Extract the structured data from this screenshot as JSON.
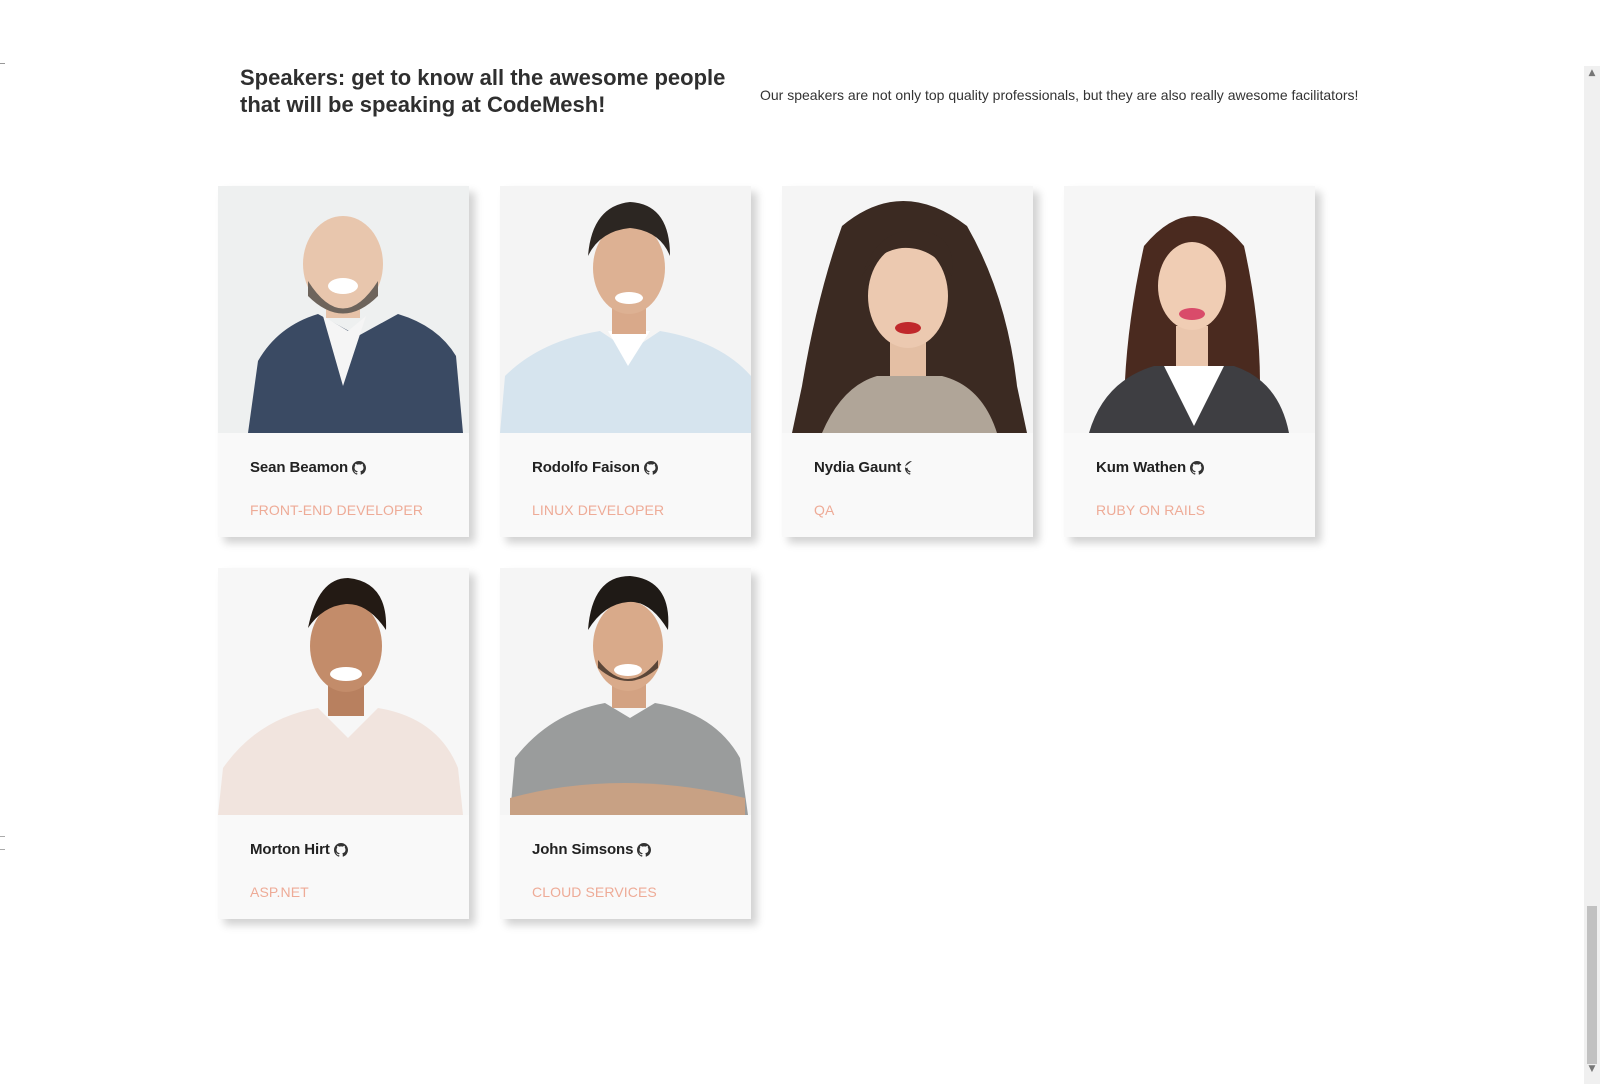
{
  "section": {
    "heading": "Speakers: get to know all the awesome people that will be speaking at CodeMesh!",
    "tagline": "Our speakers are not only top quality professionals, but they are also really awesome facilitators!"
  },
  "speakers": [
    {
      "name": "Sean Beamon",
      "role": "FRONT-END DEVELOPER"
    },
    {
      "name": "Rodolfo Faison",
      "role": "LINUX DEVELOPER"
    },
    {
      "name": "Nydia Gaunt",
      "role": "QA"
    },
    {
      "name": "Kum Wathen",
      "role": "RUBY ON RAILS"
    },
    {
      "name": "Morton Hirt",
      "role": "ASP.NET"
    },
    {
      "name": "John Simsons",
      "role": "CLOUD SERVICES"
    }
  ],
  "icons": {
    "profile_link": "github-icon"
  },
  "colors": {
    "role_text": "#eeab97",
    "card_bg": "#f7f7f7",
    "heading": "#2f2f2f"
  }
}
